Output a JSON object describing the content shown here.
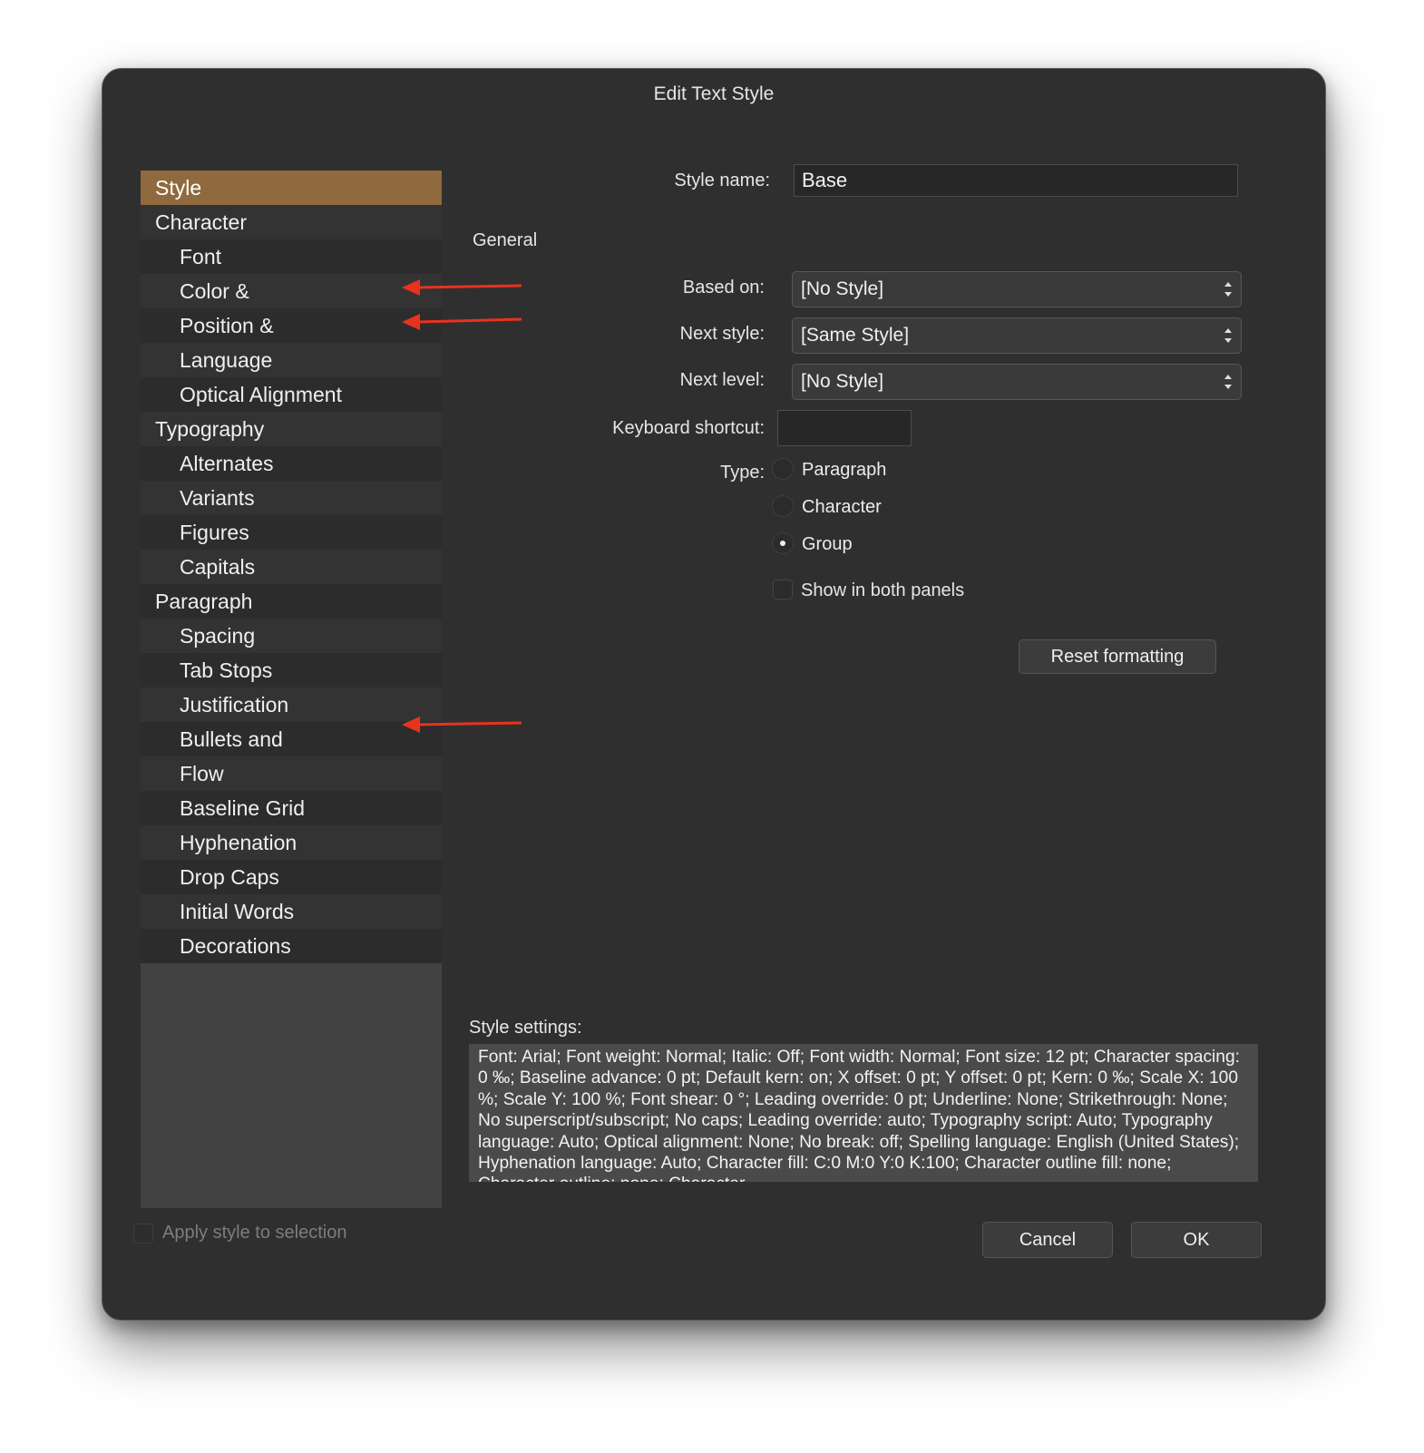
{
  "window": {
    "title": "Edit Text Style"
  },
  "sidebar": {
    "items": [
      {
        "label": "Style",
        "level": 0,
        "selected": true
      },
      {
        "label": "Character",
        "level": 0
      },
      {
        "label": "Font",
        "level": 1
      },
      {
        "label": "Color &",
        "level": 1
      },
      {
        "label": "Position &",
        "level": 1
      },
      {
        "label": "Language",
        "level": 1
      },
      {
        "label": "Optical Alignment",
        "level": 1
      },
      {
        "label": "Typography",
        "level": 0
      },
      {
        "label": "Alternates",
        "level": 1
      },
      {
        "label": "Variants",
        "level": 1
      },
      {
        "label": "Figures",
        "level": 1
      },
      {
        "label": "Capitals",
        "level": 1
      },
      {
        "label": "Paragraph",
        "level": 0
      },
      {
        "label": "Spacing",
        "level": 1
      },
      {
        "label": "Tab Stops",
        "level": 1
      },
      {
        "label": "Justification",
        "level": 1
      },
      {
        "label": "Bullets and",
        "level": 1
      },
      {
        "label": "Flow",
        "level": 1
      },
      {
        "label": "Baseline Grid",
        "level": 1
      },
      {
        "label": "Hyphenation",
        "level": 1
      },
      {
        "label": "Drop Caps",
        "level": 1
      },
      {
        "label": "Initial Words",
        "level": 1
      },
      {
        "label": "Decorations",
        "level": 1
      }
    ]
  },
  "form": {
    "style_name_label": "Style name:",
    "style_name_value": "Base",
    "section_general": "General",
    "based_on_label": "Based on:",
    "based_on_value": "[No Style]",
    "next_style_label": "Next style:",
    "next_style_value": "[Same Style]",
    "next_level_label": "Next level:",
    "next_level_value": "[No Style]",
    "keyboard_shortcut_label": "Keyboard shortcut:",
    "keyboard_shortcut_value": "",
    "type_label": "Type:",
    "type_options": [
      {
        "label": "Paragraph",
        "checked": false
      },
      {
        "label": "Character",
        "checked": false
      },
      {
        "label": "Group",
        "checked": true
      }
    ],
    "show_both_label": "Show in both panels",
    "reset_button": "Reset formatting"
  },
  "settings": {
    "label": "Style settings:",
    "text": "Font: Arial; Font weight: Normal; Italic: Off; Font width: Normal; Font size: 12 pt; Character spacing: 0 ‰; Baseline advance: 0 pt; Default kern: on; X offset: 0 pt; Y offset: 0 pt; Kern: 0 ‰; Scale X: 100 %; Scale Y: 100 %; Font shear: 0 °; Leading override: 0 pt; Underline: None; Strikethrough: None; No superscript/subscript; No caps; Leading override: auto; Typography script: Auto; Typography language: Auto; Optical alignment: None; No break: off; Spelling language: English (United States); Hyphenation language: Auto; Character fill: C:0 M:0 Y:0 K:100; Character outline fill: none; Character outline: none; Character"
  },
  "footer": {
    "apply_label": "Apply style to selection",
    "cancel_button": "Cancel",
    "ok_button": "OK"
  },
  "colors": {
    "selection": "#8f6a3f",
    "annotation_arrow": "#e8321e",
    "window_bg": "#2f2f2f"
  }
}
